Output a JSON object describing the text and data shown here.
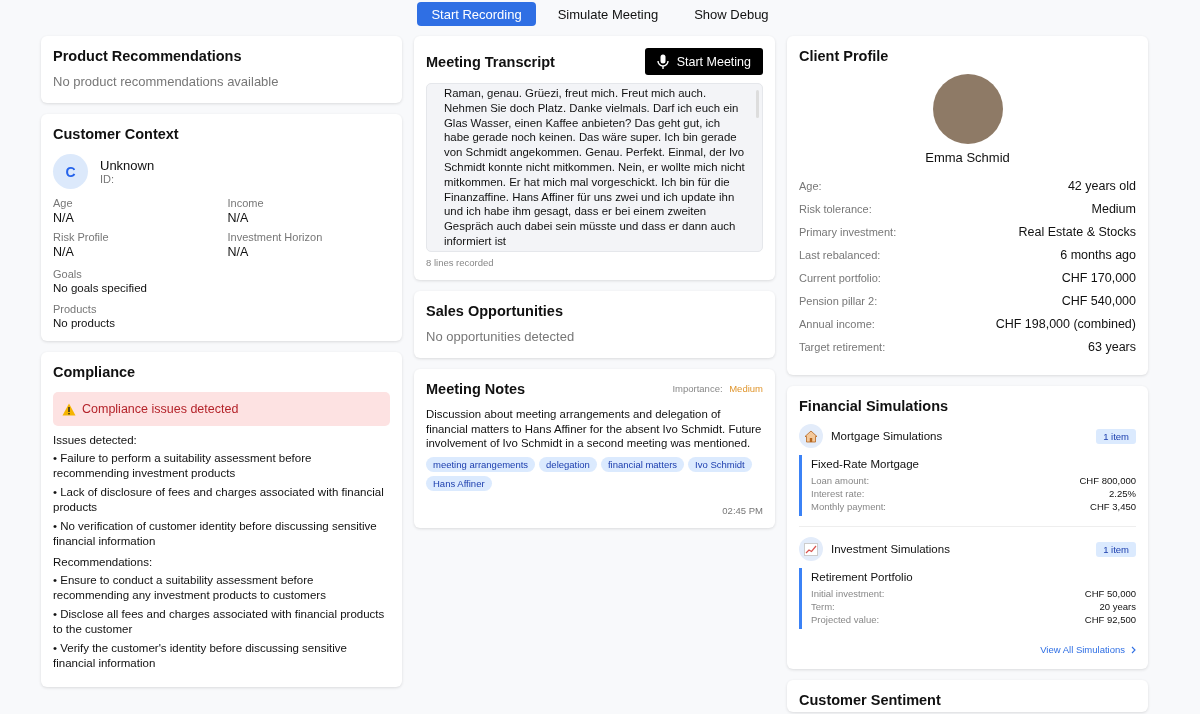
{
  "toolbar": [
    {
      "label": "Start Recording",
      "selected": true
    },
    {
      "label": "Simulate Meeting",
      "selected": false
    },
    {
      "label": "Show Debug",
      "selected": false
    }
  ],
  "product_recommendations": {
    "title": "Product Recommendations",
    "empty": "No product recommendations available"
  },
  "customer_context": {
    "title": "Customer Context",
    "avatar_letter": "C",
    "name": "Unknown",
    "id_label": "ID:",
    "fields": [
      {
        "label": "Age",
        "value": "N/A"
      },
      {
        "label": "Income",
        "value": "N/A"
      },
      {
        "label": "Risk Profile",
        "value": "N/A"
      },
      {
        "label": "Investment Horizon",
        "value": "N/A"
      }
    ],
    "sections": [
      {
        "label": "Goals",
        "value": "No goals specified"
      },
      {
        "label": "Products",
        "value": "No products"
      }
    ]
  },
  "compliance": {
    "title": "Compliance",
    "alert": {
      "kind": "warning",
      "text": "Compliance issues detected"
    },
    "groups": [
      {
        "heading": "Issues detected:",
        "items": [
          "• Failure to perform a suitability assessment before recommending investment products",
          "• Lack of disclosure of fees and charges associated with financial products",
          "• No verification of customer identity before discussing sensitive financial information"
        ]
      },
      {
        "heading": "Recommendations:",
        "items": [
          "• Ensure to conduct a suitability assessment before recommending any investment products to customers",
          "• Disclose all fees and charges associated with financial products to the customer",
          "• Verify the customer's identity before discussing sensitive financial information"
        ]
      }
    ]
  },
  "transcript": {
    "title": "Meeting Transcript",
    "button": "Start Meeting",
    "text": "Raman, genau. Grüezi, freut mich. Freut mich auch. Nehmen Sie doch Platz. Danke vielmals. Darf ich euch ein Glas Wasser, einen Kaffee anbieten? Das geht gut, ich habe gerade noch keinen. Das wäre super. Ich bin gerade von Schmidt angekommen. Genau. Perfekt. Einmal, der Ivo Schmidt konnte nicht mitkommen. Nein, er wollte mich nicht mitkommen. Er hat mich mal vorgeschickt. Ich bin für die Finanzaffine. Hans Affiner für uns zwei und ich update ihn und ich habe ihm gesagt, dass er bei einem zweiten Gespräch auch dabei sein müsste und dass er dann auch informiert ist",
    "footer": "8 lines recorded"
  },
  "sales_opportunities": {
    "title": "Sales Opportunities",
    "empty": "No opportunities detected"
  },
  "meeting_notes": {
    "title": "Meeting Notes",
    "importance_label": "Importance:",
    "importance": "Medium",
    "summary": "Discussion about meeting arrangements and delegation of financial matters to Hans Affiner for the absent Ivo Schmidt. Future involvement of Ivo Schmidt in a second meeting was mentioned.",
    "tags": [
      "meeting arrangements",
      "delegation",
      "financial matters",
      "Ivo Schmidt",
      "Hans Affiner"
    ],
    "time": "02:45 PM"
  },
  "client_profile": {
    "title": "Client Profile",
    "name": "Emma Schmid",
    "rows": [
      {
        "label": "Age:",
        "value": "42 years old"
      },
      {
        "label": "Risk tolerance:",
        "value": "Medium"
      },
      {
        "label": "Primary investment:",
        "value": "Real Estate & Stocks"
      },
      {
        "label": "Last rebalanced:",
        "value": "6 months ago"
      },
      {
        "label": "Current portfolio:",
        "value": "CHF 170,000"
      },
      {
        "label": "Pension pillar 2:",
        "value": "CHF 540,000"
      },
      {
        "label": "Annual income:",
        "value": "CHF 198,000 (combined)"
      },
      {
        "label": "Target retirement:",
        "value": "63 years"
      }
    ]
  },
  "financial_simulations": {
    "title": "Financial Simulations",
    "groups": [
      {
        "kind": "house",
        "title": "Mortgage Simulations",
        "count": "1 item",
        "item": {
          "title": "Fixed-Rate Mortgage",
          "rows": [
            {
              "label": "Loan amount:",
              "value": "CHF 800,000"
            },
            {
              "label": "Interest rate:",
              "value": "2.25%"
            },
            {
              "label": "Monthly payment:",
              "value": "CHF 3,450"
            }
          ]
        }
      },
      {
        "kind": "chart",
        "title": "Investment Simulations",
        "count": "1 item",
        "item": {
          "title": "Retirement Portfolio",
          "rows": [
            {
              "label": "Initial investment:",
              "value": "CHF 50,000"
            },
            {
              "label": "Term:",
              "value": "20 years"
            },
            {
              "label": "Projected value:",
              "value": "CHF 92,500"
            }
          ]
        }
      }
    ],
    "link": "View All Simulations"
  },
  "customer_sentiment": {
    "title": "Customer Sentiment"
  }
}
